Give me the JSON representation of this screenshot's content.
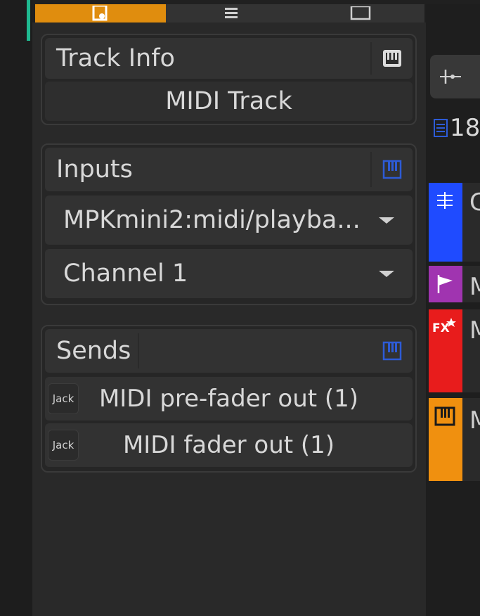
{
  "tabs": {
    "active_tab_icon": "note-icon",
    "second_tab_icon": "list-icon",
    "third_tab_icon": "square-icon"
  },
  "track_info": {
    "header": "Track Info",
    "value": "MIDI Track",
    "icon": "piano-keys-icon"
  },
  "inputs": {
    "header": "Inputs",
    "icon": "piano-keys-icon",
    "device": "MPKmini2:midi/playba...",
    "channel": "Channel 1"
  },
  "sends": {
    "header": "Sends",
    "icon": "piano-keys-icon",
    "items": [
      {
        "badge": "Jack",
        "label": "MIDI pre-fader out (1)"
      },
      {
        "badge": "Jack",
        "label": "MIDI fader out (1)"
      }
    ]
  },
  "tracklist": {
    "number": "18",
    "tracks": [
      {
        "icon": "chord-track-icon",
        "letter": "C",
        "color": "#1f4bff"
      },
      {
        "icon": "marker-flag-icon",
        "letter": "M",
        "color": "#a034b0"
      },
      {
        "icon": "fx-icon",
        "letter": "M",
        "color": "#e81c1c"
      },
      {
        "icon": "piano-keys-icon",
        "letter": "M",
        "color": "#f0900f"
      }
    ]
  },
  "colors": {
    "accent_orange": "#e08d0e",
    "accent_teal": "#1fb990",
    "icon_blue": "#2d5bd6"
  }
}
